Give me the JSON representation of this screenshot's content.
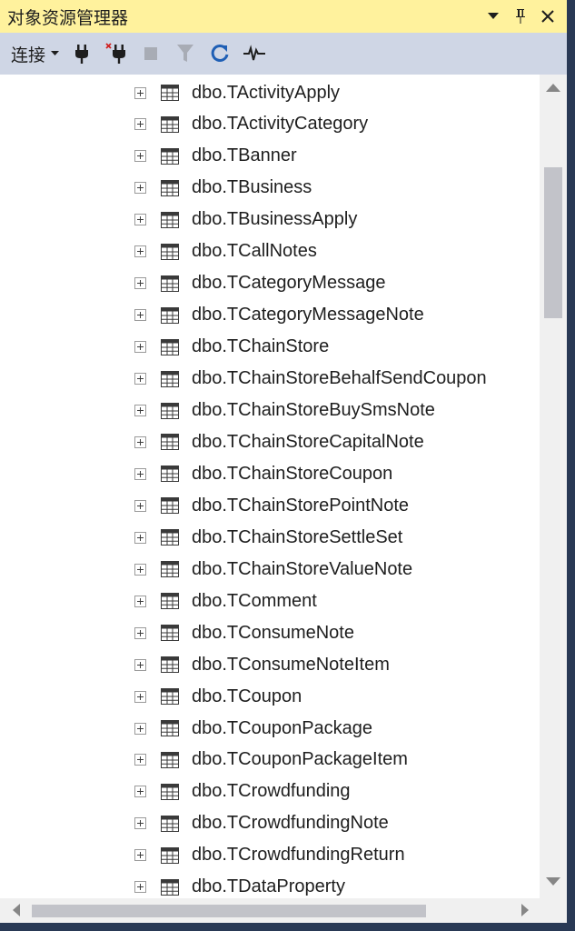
{
  "window": {
    "title": "对象资源管理器"
  },
  "title_actions": {
    "dropdown_icon": "chevron-down-icon",
    "pin_icon": "pin-icon",
    "close_icon": "close-icon"
  },
  "toolbar": {
    "connect_label": "连接"
  },
  "tree": {
    "items": [
      {
        "label": "dbo.TActivityApply"
      },
      {
        "label": "dbo.TActivityCategory"
      },
      {
        "label": "dbo.TBanner"
      },
      {
        "label": "dbo.TBusiness"
      },
      {
        "label": "dbo.TBusinessApply"
      },
      {
        "label": "dbo.TCallNotes"
      },
      {
        "label": "dbo.TCategoryMessage"
      },
      {
        "label": "dbo.TCategoryMessageNote"
      },
      {
        "label": "dbo.TChainStore"
      },
      {
        "label": "dbo.TChainStoreBehalfSendCoupon"
      },
      {
        "label": "dbo.TChainStoreBuySmsNote"
      },
      {
        "label": "dbo.TChainStoreCapitalNote"
      },
      {
        "label": "dbo.TChainStoreCoupon"
      },
      {
        "label": "dbo.TChainStorePointNote"
      },
      {
        "label": "dbo.TChainStoreSettleSet"
      },
      {
        "label": "dbo.TChainStoreValueNote"
      },
      {
        "label": "dbo.TComment"
      },
      {
        "label": "dbo.TConsumeNote"
      },
      {
        "label": "dbo.TConsumeNoteItem"
      },
      {
        "label": "dbo.TCoupon"
      },
      {
        "label": "dbo.TCouponPackage"
      },
      {
        "label": "dbo.TCouponPackageItem"
      },
      {
        "label": "dbo.TCrowdfunding"
      },
      {
        "label": "dbo.TCrowdfundingNote"
      },
      {
        "label": "dbo.TCrowdfundingReturn"
      },
      {
        "label": "dbo.TDataProperty"
      }
    ]
  },
  "colors": {
    "title_bg": "#fff29d",
    "toolbar_bg": "#cfd6e5",
    "frame": "#293955",
    "refresh_blue": "#1f5fb5"
  }
}
